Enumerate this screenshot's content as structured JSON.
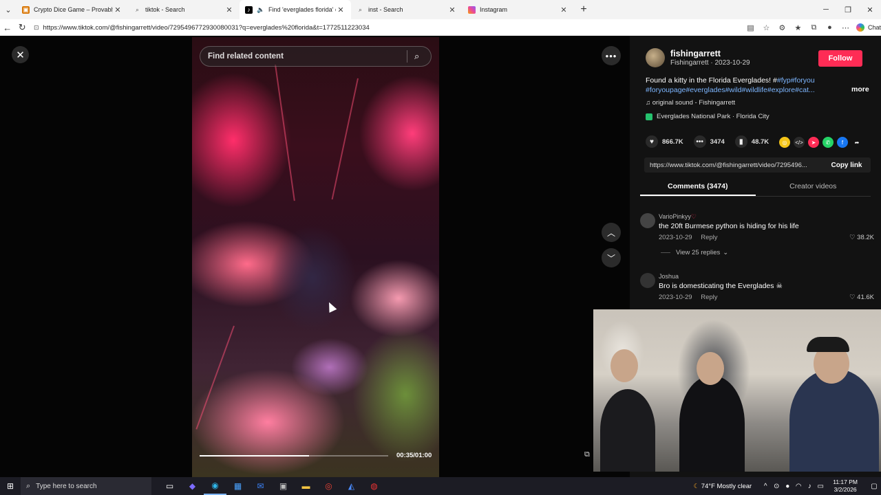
{
  "browser": {
    "tabs": [
      {
        "label": "Crypto Dice Game – Provably Fair",
        "favicon": "dice-icon",
        "active": false
      },
      {
        "label": "tiktok - Search",
        "favicon": "search-icon",
        "active": false
      },
      {
        "label": "Find 'everglades florida' on TikTok",
        "favicon": "tiktok-icon",
        "active": true
      },
      {
        "label": "inst - Search",
        "favicon": "search-icon",
        "active": false
      },
      {
        "label": "Instagram",
        "favicon": "instagram-icon",
        "active": false
      }
    ],
    "url": "https://www.tiktok.com/@fishingarrett/video/7295496772930080031?q=everglades%20florida&t=1772511223034",
    "chat_label": "Chat"
  },
  "video": {
    "search_placeholder": "Find related content",
    "timecode": "00:35/01:00",
    "progress_fraction": 0.58
  },
  "post": {
    "username": "fishingarrett",
    "subline": "Fishingarrett · 2023-10-29",
    "follow_label": "Follow",
    "description_line1": "Found a kitty in the Florida Everglades! #",
    "description_tags1": "#fyp#foryou",
    "description_line2": "#foryoupage#everglades#wild#wildlife#explore#cat...",
    "more_label": "more",
    "sound": "original sound - Fishingarrett",
    "location": "Everglades National Park · Florida City",
    "likes": "866.7K",
    "comments": "3474",
    "saves": "48.7K",
    "share_link": "https://www.tiktok.com/@fishingarrett/video/7295496...",
    "copy_link_label": "Copy link"
  },
  "tabs2": {
    "comments_label": "Comments (3474)",
    "creator_label": "Creator videos"
  },
  "comments": [
    {
      "user": "VarioPinkyy",
      "text": "the 20ft Burmese python is hiding for his life",
      "date": "2023-10-29",
      "reply": "Reply",
      "likes": "38.2K"
    },
    {
      "user": "Joshua",
      "text": "Bro is domesticating the Everglades",
      "date": "2023-10-29",
      "reply": "Reply",
      "likes": "41.6K"
    }
  ],
  "view_replies": "View 25 replies",
  "taskbar": {
    "search_placeholder": "Type here to search",
    "weather": "74°F  Mostly clear",
    "time": "11:17 PM",
    "date": "3/2/2026"
  },
  "colors": {
    "follow": "#fe2c55",
    "tag": "#7db6ff",
    "panel_bg": "#121212"
  }
}
